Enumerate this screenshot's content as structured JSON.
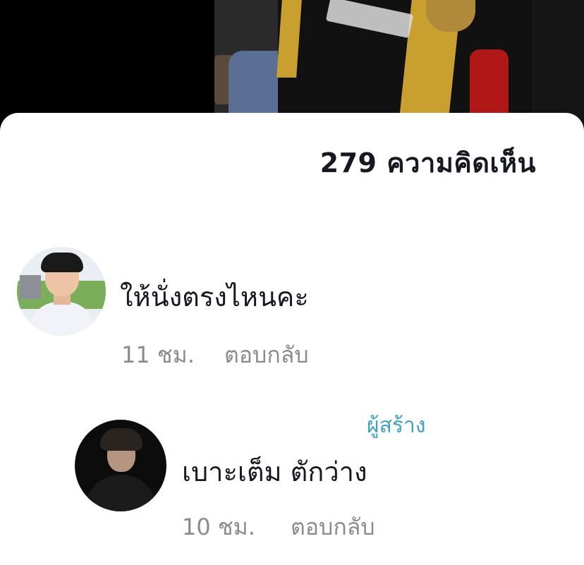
{
  "comments_header": {
    "count": "279",
    "label": "ความคิดเห็น"
  },
  "comments": [
    {
      "text": "ให้นั่งตรงไหนคะ",
      "time": "11 ชม.",
      "reply_label": "ตอบกลับ"
    },
    {
      "badge": "ผู้สร้าง",
      "text": "เบาะเต็ม ตักว่าง",
      "time": "10 ชม.",
      "reply_label": "ตอบกลับ"
    }
  ],
  "colors": {
    "sheet_background": "#ffffff",
    "primary_text": "#161823",
    "secondary_text": "#8a8b91",
    "creator_badge": "#3fa2c3"
  }
}
